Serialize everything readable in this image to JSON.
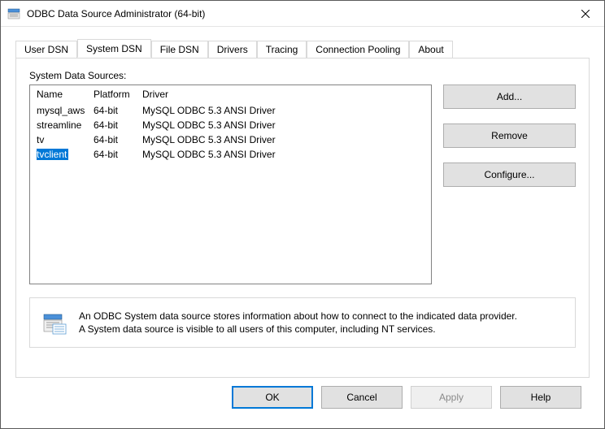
{
  "window": {
    "title": "ODBC Data Source Administrator (64-bit)"
  },
  "tabs": [
    {
      "label": "User DSN"
    },
    {
      "label": "System DSN"
    },
    {
      "label": "File DSN"
    },
    {
      "label": "Drivers"
    },
    {
      "label": "Tracing"
    },
    {
      "label": "Connection Pooling"
    },
    {
      "label": "About"
    }
  ],
  "section_label": "System Data Sources:",
  "columns": {
    "name": "Name",
    "platform": "Platform",
    "driver": "Driver"
  },
  "rows": [
    {
      "name": "mysql_aws",
      "platform": "64-bit",
      "driver": "MySQL ODBC 5.3 ANSI Driver",
      "selected": false
    },
    {
      "name": "streamline",
      "platform": "64-bit",
      "driver": "MySQL ODBC 5.3 ANSI Driver",
      "selected": false
    },
    {
      "name": "tv",
      "platform": "64-bit",
      "driver": "MySQL ODBC 5.3 ANSI Driver",
      "selected": false
    },
    {
      "name": "tvclient",
      "platform": "64-bit",
      "driver": "MySQL ODBC 5.3 ANSI Driver",
      "selected": true
    }
  ],
  "side_buttons": {
    "add": "Add...",
    "remove": "Remove",
    "configure": "Configure..."
  },
  "info_text_line1": "An ODBC System data source stores information about how to connect to the indicated data provider.",
  "info_text_line2": "A System data source is visible to all users of this computer, including NT services.",
  "footer": {
    "ok": "OK",
    "cancel": "Cancel",
    "apply": "Apply",
    "help": "Help"
  }
}
